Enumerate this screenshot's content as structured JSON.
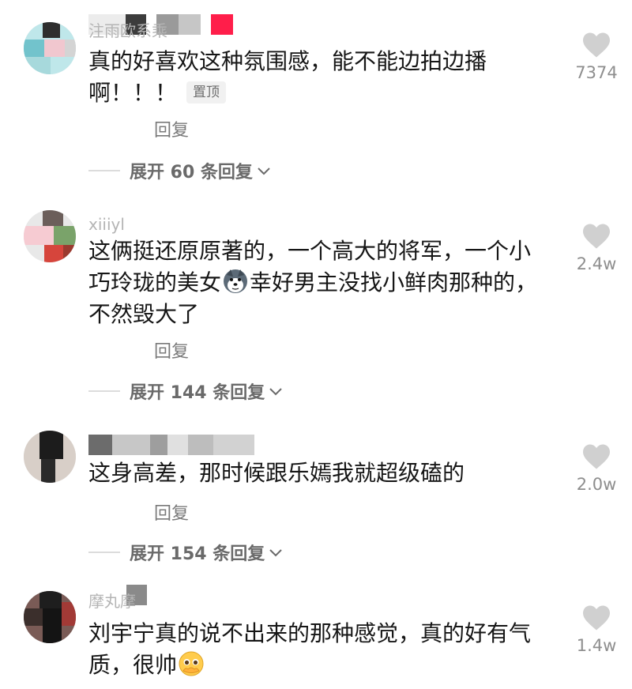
{
  "comments": [
    {
      "username": "注雨欧系乘",
      "lines": [
        "真的好喜欢这种氛围感，能不能边拍边播",
        "啊！！！"
      ],
      "pinned_label": "置顶",
      "reply_label": "回复",
      "expand_label": "展开 60 条回复",
      "likes": "7374"
    },
    {
      "username": "xiiiyl",
      "lines": [
        "这俩挺还原原著的，一个高大的将军，一个小",
        "巧玲珑的美女",
        "幸好男主没找小鲜肉那种的，",
        "不然毁大了"
      ],
      "reply_label": "回复",
      "expand_label": "展开 144 条回复",
      "likes": "2.4w"
    },
    {
      "username": "",
      "lines": [
        "这身高差，那时候跟乐嫣我就超级磕的"
      ],
      "reply_label": "回复",
      "expand_label": "展开 154 条回复",
      "likes": "2.0w"
    },
    {
      "username": "摩丸摩",
      "lines": [
        "刘宇宁真的说不出来的那种感觉，真的好有气",
        "质，很帅"
      ],
      "likes": "1.4w"
    }
  ],
  "icons": {
    "like": "heart-icon",
    "expand": "chevron-down-icon",
    "emoji_1": "husky-dog-emoji",
    "emoji_2": "pleading-face-emoji"
  },
  "colors": {
    "text": "#161616",
    "secondary": "#8e8e8e",
    "heart": "#d0d0d0",
    "pin_badge_bg": "#f1f1f1"
  }
}
